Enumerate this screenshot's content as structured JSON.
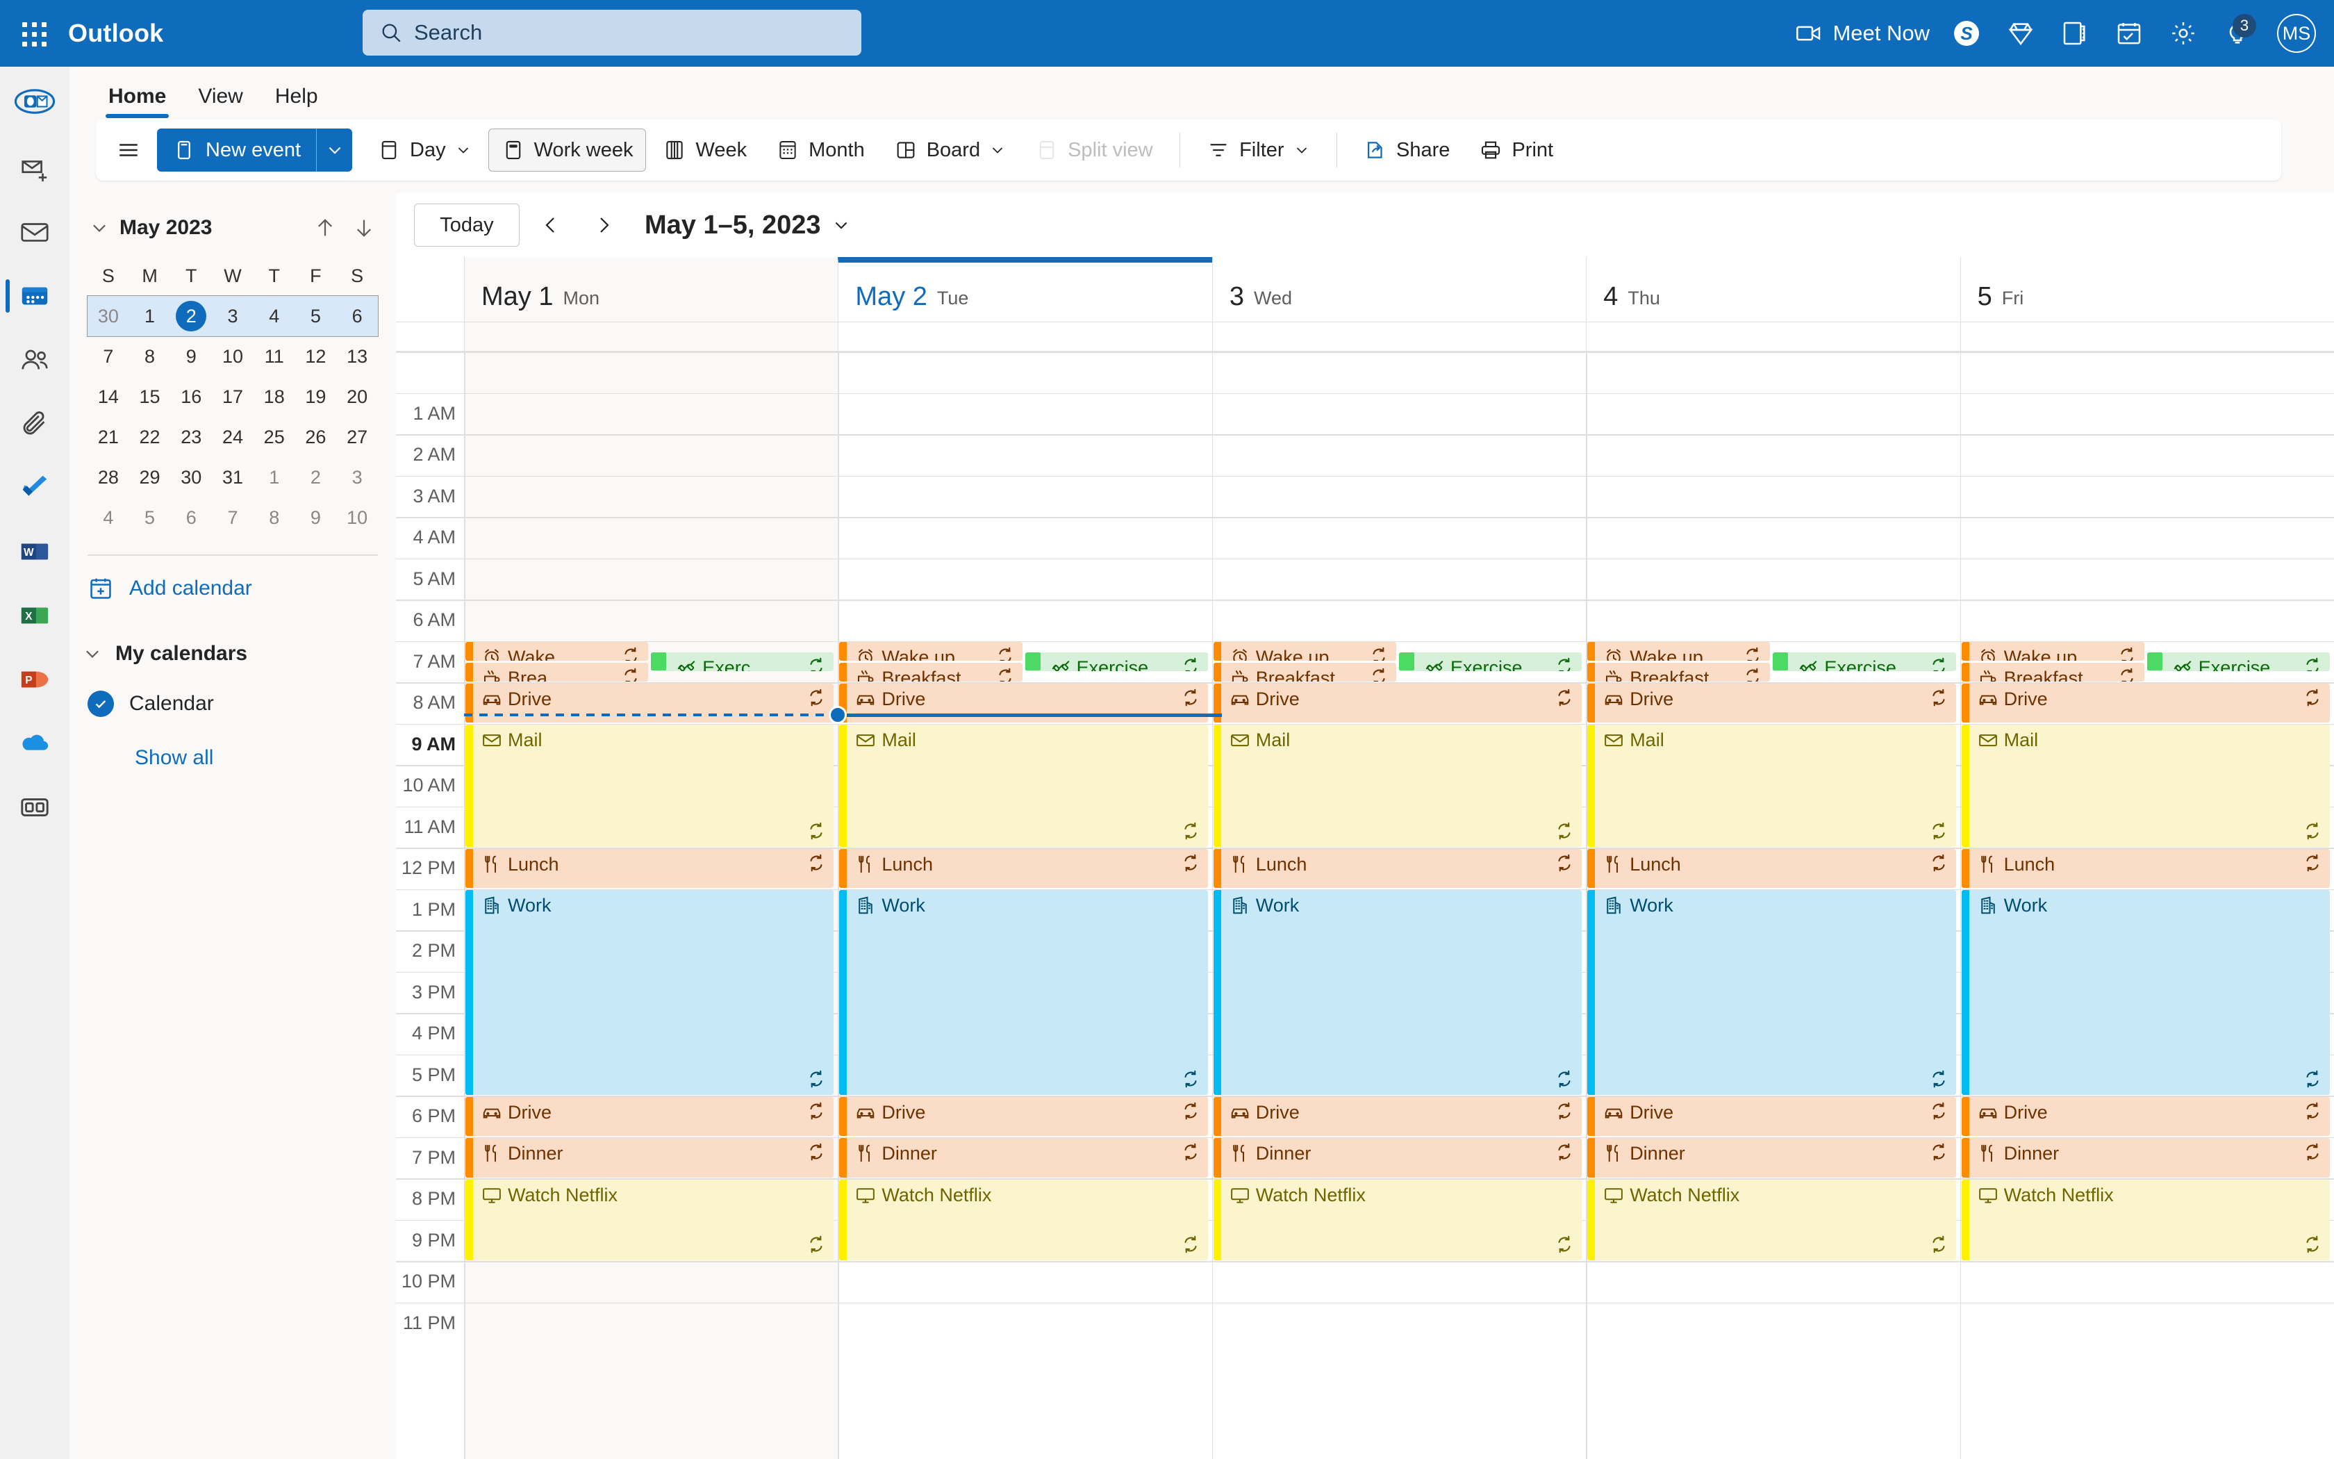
{
  "app": {
    "brand": "Outlook",
    "waffle_icon": "app-launcher-icon",
    "search_placeholder": "Search",
    "search_value": "",
    "search_icon": "search-icon"
  },
  "topbar_right": {
    "meet_now": "Meet Now",
    "meet_now_icon": "video-camera-icon",
    "icons": [
      {
        "name": "skype-icon",
        "label": "S"
      },
      {
        "name": "diamond-icon",
        "label": ""
      },
      {
        "name": "onenote-icon",
        "label": "N"
      },
      {
        "name": "to-do-icon",
        "label": ""
      },
      {
        "name": "settings-gear-icon",
        "label": ""
      },
      {
        "name": "lightbulb-help-icon",
        "label": "",
        "badge": "3"
      }
    ],
    "avatar_initials": "MS"
  },
  "rail": {
    "logo": "outlook-logo-icon",
    "items": [
      {
        "name": "new-mail-icon",
        "active": false
      },
      {
        "name": "mail-icon",
        "active": false
      },
      {
        "name": "calendar-icon",
        "active": true
      },
      {
        "name": "people-icon",
        "active": false
      },
      {
        "name": "files-attachment-icon",
        "active": false
      },
      {
        "name": "to-do-icon",
        "active": false
      },
      {
        "name": "word-icon",
        "active": false
      },
      {
        "name": "excel-icon",
        "active": false
      },
      {
        "name": "powerpoint-icon",
        "active": false
      },
      {
        "name": "onedrive-icon",
        "active": false
      },
      {
        "name": "all-apps-icon",
        "active": false
      }
    ]
  },
  "ribbon": {
    "tabs": [
      {
        "label": "Home",
        "active": true
      },
      {
        "label": "View",
        "active": false
      },
      {
        "label": "Help",
        "active": false
      }
    ],
    "hamburger_icon": "hamburger-menu-icon",
    "new_event": "New event",
    "new_event_icon": "new-event-icon",
    "new_event_caret_icon": "chevron-down-icon",
    "commands": [
      {
        "label": "Day",
        "icon": "day-view-icon",
        "caret": true,
        "active": false,
        "disabled": false
      },
      {
        "label": "Work week",
        "icon": "work-week-icon",
        "caret": false,
        "active": true,
        "disabled": false
      },
      {
        "label": "Week",
        "icon": "week-view-icon",
        "caret": false,
        "active": false,
        "disabled": false
      },
      {
        "label": "Month",
        "icon": "month-view-icon",
        "caret": false,
        "active": false,
        "disabled": false
      },
      {
        "label": "Board",
        "icon": "board-view-icon",
        "caret": true,
        "active": false,
        "disabled": false
      },
      {
        "label": "Split view",
        "icon": "split-view-icon",
        "caret": false,
        "active": false,
        "disabled": true
      },
      {
        "label": "Filter",
        "icon": "filter-icon",
        "caret": true,
        "active": false,
        "disabled": false
      },
      {
        "label": "Share",
        "icon": "share-icon",
        "caret": false,
        "active": false,
        "disabled": false
      },
      {
        "label": "Print",
        "icon": "print-icon",
        "caret": false,
        "active": false,
        "disabled": false
      }
    ],
    "collapse_icon": "chevron-down-icon"
  },
  "mini_calendar": {
    "collapse_icon": "chevron-down-icon",
    "title": "May 2023",
    "prev_icon": "arrow-up-icon",
    "next_icon": "arrow-down-icon",
    "day_initials": [
      "S",
      "M",
      "T",
      "W",
      "T",
      "F",
      "S"
    ],
    "weeks": [
      {
        "selected": true,
        "days": [
          {
            "d": "30",
            "muted": true
          },
          {
            "d": "1"
          },
          {
            "d": "2",
            "today": true
          },
          {
            "d": "3"
          },
          {
            "d": "4"
          },
          {
            "d": "5"
          },
          {
            "d": "6"
          }
        ]
      },
      {
        "selected": false,
        "days": [
          {
            "d": "7"
          },
          {
            "d": "8"
          },
          {
            "d": "9"
          },
          {
            "d": "10"
          },
          {
            "d": "11"
          },
          {
            "d": "12"
          },
          {
            "d": "13"
          }
        ]
      },
      {
        "selected": false,
        "days": [
          {
            "d": "14"
          },
          {
            "d": "15"
          },
          {
            "d": "16"
          },
          {
            "d": "17"
          },
          {
            "d": "18"
          },
          {
            "d": "19"
          },
          {
            "d": "20"
          }
        ]
      },
      {
        "selected": false,
        "days": [
          {
            "d": "21"
          },
          {
            "d": "22"
          },
          {
            "d": "23"
          },
          {
            "d": "24"
          },
          {
            "d": "25"
          },
          {
            "d": "26"
          },
          {
            "d": "27"
          }
        ]
      },
      {
        "selected": false,
        "days": [
          {
            "d": "28"
          },
          {
            "d": "29"
          },
          {
            "d": "30"
          },
          {
            "d": "31"
          },
          {
            "d": "1",
            "muted": true
          },
          {
            "d": "2",
            "muted": true
          },
          {
            "d": "3",
            "muted": true
          }
        ]
      },
      {
        "selected": false,
        "days": [
          {
            "d": "4",
            "muted": true
          },
          {
            "d": "5",
            "muted": true
          },
          {
            "d": "6",
            "muted": true
          },
          {
            "d": "7",
            "muted": true
          },
          {
            "d": "8",
            "muted": true
          },
          {
            "d": "9",
            "muted": true
          },
          {
            "d": "10",
            "muted": true
          }
        ]
      }
    ]
  },
  "left_pane": {
    "add_calendar": "Add calendar",
    "add_calendar_icon": "add-calendar-icon",
    "my_calendars": "My calendars",
    "my_calendars_chevron": "chevron-down-icon",
    "calendar_name": "Calendar",
    "calendar_checked": true,
    "show_all": "Show all"
  },
  "calendar_header": {
    "today": "Today",
    "prev_icon": "chevron-left-icon",
    "next_icon": "chevron-right-icon",
    "range": "May 1–5, 2023",
    "range_caret_icon": "chevron-down-icon"
  },
  "calendar": {
    "days": [
      {
        "num": "May 1",
        "dow": "Mon",
        "selected": false,
        "shaded": true
      },
      {
        "num": "May 2",
        "dow": "Tue",
        "selected": true,
        "shaded": false
      },
      {
        "num": "3",
        "dow": "Wed",
        "selected": false,
        "shaded": false
      },
      {
        "num": "4",
        "dow": "Thu",
        "selected": false,
        "shaded": false
      },
      {
        "num": "5",
        "dow": "Fri",
        "selected": false,
        "shaded": false
      }
    ],
    "hour_labels": [
      "",
      "1 AM",
      "2 AM",
      "3 AM",
      "4 AM",
      "5 AM",
      "6 AM",
      "7 AM",
      "8 AM",
      "9 AM",
      "10 AM",
      "11 AM",
      "12 PM",
      "1 PM",
      "2 PM",
      "3 PM",
      "4 PM",
      "5 PM",
      "6 PM",
      "7 PM",
      "8 PM",
      "9 PM",
      "10 PM",
      "11 PM"
    ],
    "current_hour_label": "9 AM",
    "now_indicator_hour": 8.75,
    "colors": {
      "accent": "#0F6CBD",
      "orange_fill": "#FBDCC6",
      "orange_stripe": "#FF8C00",
      "orange_text": "#6E3200",
      "yellow_fill": "#FAF5CD",
      "yellow_stripe": "#FFF100",
      "yellow_text": "#6E6400",
      "blue_fill": "#C7E9F7",
      "blue_stripe": "#00BCF2",
      "blue_text": "#004E6E",
      "green_fill": "#D7F0D9",
      "green_stripe": "#4CD964",
      "green_text": "#0B6A0B"
    },
    "events": [
      {
        "day": 0,
        "title": "Wake",
        "full_title": "Wake up",
        "icon": "alarm-clock-icon",
        "color": "orange",
        "start": 7,
        "end": 7.5,
        "lane": 0,
        "lanes": 2,
        "recurring": true
      },
      {
        "day": 0,
        "title": "Brea",
        "full_title": "Breakfast",
        "icon": "coffee-cup-icon",
        "color": "orange",
        "start": 7.5,
        "end": 8,
        "lane": 0,
        "lanes": 2,
        "recurring": true
      },
      {
        "day": 0,
        "title": "Exerc",
        "full_title": "Exercise",
        "icon": "dumbbell-icon",
        "color": "green",
        "start": 7.25,
        "end": 7.75,
        "lane": 1,
        "lanes": 2,
        "recurring": true
      },
      {
        "day": 0,
        "title": "Drive",
        "icon": "car-icon",
        "color": "orange",
        "start": 8,
        "end": 9,
        "lane": 0,
        "lanes": 1,
        "recurring": true
      },
      {
        "day": 0,
        "title": "Mail",
        "icon": "envelope-icon",
        "color": "yellow",
        "start": 9,
        "end": 12,
        "lane": 0,
        "lanes": 1,
        "recurring": true
      },
      {
        "day": 0,
        "title": "Lunch",
        "icon": "cutlery-icon",
        "color": "orange",
        "start": 12,
        "end": 13,
        "lane": 0,
        "lanes": 1,
        "recurring": true
      },
      {
        "day": 0,
        "title": "Work",
        "icon": "office-building-icon",
        "color": "blue",
        "start": 13,
        "end": 18,
        "lane": 0,
        "lanes": 1,
        "recurring": true
      },
      {
        "day": 0,
        "title": "Drive",
        "icon": "car-icon",
        "color": "orange",
        "start": 18,
        "end": 19,
        "lane": 0,
        "lanes": 1,
        "recurring": true
      },
      {
        "day": 0,
        "title": "Dinner",
        "icon": "cutlery-icon",
        "color": "orange",
        "start": 19,
        "end": 20,
        "lane": 0,
        "lanes": 1,
        "recurring": true
      },
      {
        "day": 0,
        "title": "Watch Netflix",
        "icon": "monitor-icon",
        "color": "yellow",
        "start": 20,
        "end": 22,
        "lane": 0,
        "lanes": 1,
        "recurring": true
      },
      {
        "day": 1,
        "title": "Wake up",
        "icon": "alarm-clock-icon",
        "color": "orange",
        "start": 7,
        "end": 7.5,
        "lane": 0,
        "lanes": 2,
        "recurring": true
      },
      {
        "day": 1,
        "title": "Breakfast",
        "icon": "coffee-cup-icon",
        "color": "orange",
        "start": 7.5,
        "end": 8,
        "lane": 0,
        "lanes": 2,
        "recurring": true
      },
      {
        "day": 1,
        "title": "Exercise",
        "icon": "dumbbell-icon",
        "color": "green",
        "start": 7.25,
        "end": 7.75,
        "lane": 1,
        "lanes": 2,
        "recurring": true
      },
      {
        "day": 1,
        "title": "Drive",
        "icon": "car-icon",
        "color": "orange",
        "start": 8,
        "end": 9,
        "lane": 0,
        "lanes": 1,
        "recurring": true
      },
      {
        "day": 1,
        "title": "Mail",
        "icon": "envelope-icon",
        "color": "yellow",
        "start": 9,
        "end": 12,
        "lane": 0,
        "lanes": 1,
        "recurring": true
      },
      {
        "day": 1,
        "title": "Lunch",
        "icon": "cutlery-icon",
        "color": "orange",
        "start": 12,
        "end": 13,
        "lane": 0,
        "lanes": 1,
        "recurring": true
      },
      {
        "day": 1,
        "title": "Work",
        "icon": "office-building-icon",
        "color": "blue",
        "start": 13,
        "end": 18,
        "lane": 0,
        "lanes": 1,
        "recurring": true
      },
      {
        "day": 1,
        "title": "Drive",
        "icon": "car-icon",
        "color": "orange",
        "start": 18,
        "end": 19,
        "lane": 0,
        "lanes": 1,
        "recurring": true
      },
      {
        "day": 1,
        "title": "Dinner",
        "icon": "cutlery-icon",
        "color": "orange",
        "start": 19,
        "end": 20,
        "lane": 0,
        "lanes": 1,
        "recurring": true
      },
      {
        "day": 1,
        "title": "Watch Netflix",
        "icon": "monitor-icon",
        "color": "yellow",
        "start": 20,
        "end": 22,
        "lane": 0,
        "lanes": 1,
        "recurring": true
      },
      {
        "day": 2,
        "title": "Wake up",
        "icon": "alarm-clock-icon",
        "color": "orange",
        "start": 7,
        "end": 7.5,
        "lane": 0,
        "lanes": 2,
        "recurring": true
      },
      {
        "day": 2,
        "title": "Breakfast",
        "icon": "coffee-cup-icon",
        "color": "orange",
        "start": 7.5,
        "end": 8,
        "lane": 0,
        "lanes": 2,
        "recurring": true
      },
      {
        "day": 2,
        "title": "Exercise",
        "icon": "dumbbell-icon",
        "color": "green",
        "start": 7.25,
        "end": 7.75,
        "lane": 1,
        "lanes": 2,
        "recurring": true
      },
      {
        "day": 2,
        "title": "Drive",
        "icon": "car-icon",
        "color": "orange",
        "start": 8,
        "end": 9,
        "lane": 0,
        "lanes": 1,
        "recurring": true
      },
      {
        "day": 2,
        "title": "Mail",
        "icon": "envelope-icon",
        "color": "yellow",
        "start": 9,
        "end": 12,
        "lane": 0,
        "lanes": 1,
        "recurring": true
      },
      {
        "day": 2,
        "title": "Lunch",
        "icon": "cutlery-icon",
        "color": "orange",
        "start": 12,
        "end": 13,
        "lane": 0,
        "lanes": 1,
        "recurring": true
      },
      {
        "day": 2,
        "title": "Work",
        "icon": "office-building-icon",
        "color": "blue",
        "start": 13,
        "end": 18,
        "lane": 0,
        "lanes": 1,
        "recurring": true
      },
      {
        "day": 2,
        "title": "Drive",
        "icon": "car-icon",
        "color": "orange",
        "start": 18,
        "end": 19,
        "lane": 0,
        "lanes": 1,
        "recurring": true
      },
      {
        "day": 2,
        "title": "Dinner",
        "icon": "cutlery-icon",
        "color": "orange",
        "start": 19,
        "end": 20,
        "lane": 0,
        "lanes": 1,
        "recurring": true
      },
      {
        "day": 2,
        "title": "Watch Netflix",
        "icon": "monitor-icon",
        "color": "yellow",
        "start": 20,
        "end": 22,
        "lane": 0,
        "lanes": 1,
        "recurring": true
      },
      {
        "day": 3,
        "title": "Wake up",
        "icon": "alarm-clock-icon",
        "color": "orange",
        "start": 7,
        "end": 7.5,
        "lane": 0,
        "lanes": 2,
        "recurring": true
      },
      {
        "day": 3,
        "title": "Breakfast",
        "icon": "coffee-cup-icon",
        "color": "orange",
        "start": 7.5,
        "end": 8,
        "lane": 0,
        "lanes": 2,
        "recurring": true
      },
      {
        "day": 3,
        "title": "Exercise",
        "icon": "dumbbell-icon",
        "color": "green",
        "start": 7.25,
        "end": 7.75,
        "lane": 1,
        "lanes": 2,
        "recurring": true
      },
      {
        "day": 3,
        "title": "Drive",
        "icon": "car-icon",
        "color": "orange",
        "start": 8,
        "end": 9,
        "lane": 0,
        "lanes": 1,
        "recurring": true
      },
      {
        "day": 3,
        "title": "Mail",
        "icon": "envelope-icon",
        "color": "yellow",
        "start": 9,
        "end": 12,
        "lane": 0,
        "lanes": 1,
        "recurring": true
      },
      {
        "day": 3,
        "title": "Lunch",
        "icon": "cutlery-icon",
        "color": "orange",
        "start": 12,
        "end": 13,
        "lane": 0,
        "lanes": 1,
        "recurring": true
      },
      {
        "day": 3,
        "title": "Work",
        "icon": "office-building-icon",
        "color": "blue",
        "start": 13,
        "end": 18,
        "lane": 0,
        "lanes": 1,
        "recurring": true
      },
      {
        "day": 3,
        "title": "Drive",
        "icon": "car-icon",
        "color": "orange",
        "start": 18,
        "end": 19,
        "lane": 0,
        "lanes": 1,
        "recurring": true
      },
      {
        "day": 3,
        "title": "Dinner",
        "icon": "cutlery-icon",
        "color": "orange",
        "start": 19,
        "end": 20,
        "lane": 0,
        "lanes": 1,
        "recurring": true
      },
      {
        "day": 3,
        "title": "Watch Netflix",
        "icon": "monitor-icon",
        "color": "yellow",
        "start": 20,
        "end": 22,
        "lane": 0,
        "lanes": 1,
        "recurring": true
      },
      {
        "day": 4,
        "title": "Wake up",
        "icon": "alarm-clock-icon",
        "color": "orange",
        "start": 7,
        "end": 7.5,
        "lane": 0,
        "lanes": 2,
        "recurring": true
      },
      {
        "day": 4,
        "title": "Breakfast",
        "icon": "coffee-cup-icon",
        "color": "orange",
        "start": 7.5,
        "end": 8,
        "lane": 0,
        "lanes": 2,
        "recurring": true
      },
      {
        "day": 4,
        "title": "Exercise",
        "icon": "dumbbell-icon",
        "color": "green",
        "start": 7.25,
        "end": 7.75,
        "lane": 1,
        "lanes": 2,
        "recurring": true
      },
      {
        "day": 4,
        "title": "Drive",
        "icon": "car-icon",
        "color": "orange",
        "start": 8,
        "end": 9,
        "lane": 0,
        "lanes": 1,
        "recurring": true
      },
      {
        "day": 4,
        "title": "Mail",
        "icon": "envelope-icon",
        "color": "yellow",
        "start": 9,
        "end": 12,
        "lane": 0,
        "lanes": 1,
        "recurring": true
      },
      {
        "day": 4,
        "title": "Lunch",
        "icon": "cutlery-icon",
        "color": "orange",
        "start": 12,
        "end": 13,
        "lane": 0,
        "lanes": 1,
        "recurring": true
      },
      {
        "day": 4,
        "title": "Work",
        "icon": "office-building-icon",
        "color": "blue",
        "start": 13,
        "end": 18,
        "lane": 0,
        "lanes": 1,
        "recurring": true
      },
      {
        "day": 4,
        "title": "Drive",
        "icon": "car-icon",
        "color": "orange",
        "start": 18,
        "end": 19,
        "lane": 0,
        "lanes": 1,
        "recurring": true
      },
      {
        "day": 4,
        "title": "Dinner",
        "icon": "cutlery-icon",
        "color": "orange",
        "start": 19,
        "end": 20,
        "lane": 0,
        "lanes": 1,
        "recurring": true
      },
      {
        "day": 4,
        "title": "Watch Netflix",
        "icon": "monitor-icon",
        "color": "yellow",
        "start": 20,
        "end": 22,
        "lane": 0,
        "lanes": 1,
        "recurring": true
      }
    ]
  }
}
